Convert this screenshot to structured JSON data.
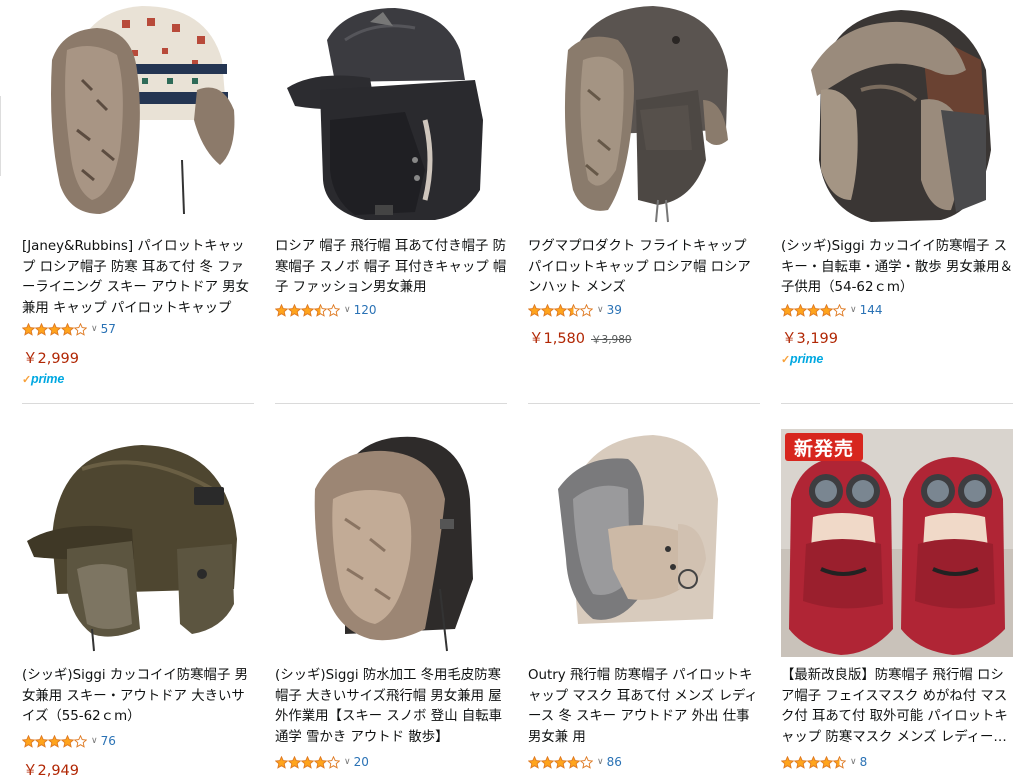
{
  "products": [
    {
      "title": "[Janey&Rubbins] パイロットキャップ ロシア帽子 防寒 耳あて付 冬 ファーライニング スキー アウトドア 男女兼用 キャップ パイロットキャップ",
      "rating": 4.0,
      "reviews": "57",
      "price": "￥2,999",
      "prime": true
    },
    {
      "title": "ロシア 帽子 飛行帽 耳あて付き帽子 防寒帽子 スノボ 帽子 耳付きキャップ 帽子 ファッション男女兼用",
      "rating": 3.5,
      "reviews": "120",
      "price": "",
      "prime": false
    },
    {
      "title": "ワグマプロダクト フライトキャップ パイロットキャップ ロシア帽 ロシアンハット メンズ",
      "rating": 3.5,
      "reviews": "39",
      "price": "￥1,580",
      "list_price": "￥3,980",
      "prime": false
    },
    {
      "title": "(シッギ)Siggi カッコイイ防寒帽子 スキー・自転車・通学・散歩 男女兼用＆子供用（54-62ｃm）",
      "rating": 4.0,
      "reviews": "144",
      "price": "￥3,199",
      "prime": true
    },
    {
      "title": "(シッギ)Siggi カッコイイ防寒帽子 男女兼用 スキー・アウトドア 大きいサイズ（55-62ｃm）",
      "rating": 4.0,
      "reviews": "76",
      "price": "￥2,949",
      "prime": false
    },
    {
      "title": "(シッギ)Siggi 防水加工 冬用毛皮防寒帽子 大きいサイズ飛行帽 男女兼用 屋外作業用【スキー スノボ 登山 自転車 通学 雪かき アウトド 散歩】",
      "rating": 4.0,
      "reviews": "20",
      "price": "",
      "prime": false
    },
    {
      "title": "Outry 飛行帽 防寒帽子 パイロットキャップ マスク 耳あて付 メンズ レディース 冬 スキー アウトドア 外出 仕事 男女兼 用",
      "rating": 4.0,
      "reviews": "86",
      "price": "",
      "prime": false
    },
    {
      "title": "【最新改良版】防寒帽子 飛行帽 ロシア帽子 フェイスマスク めがね付 マスク付 耳あて付 取外可能 パイロットキャップ 防寒マスク メンズ レディー…",
      "rating": 4.5,
      "reviews": "8",
      "price": "",
      "prime": false,
      "badge": "新発売"
    }
  ],
  "icons": {
    "star": "star-icon",
    "chevron": "chevron-down-icon",
    "prime_check": "check-icon"
  },
  "colors": {
    "price": "#b12704",
    "link": "#2a72b5",
    "star": "#ffa41c",
    "prime": "#00a8e1",
    "badge": "#d7261e"
  },
  "labels": {
    "prime": "prime"
  }
}
